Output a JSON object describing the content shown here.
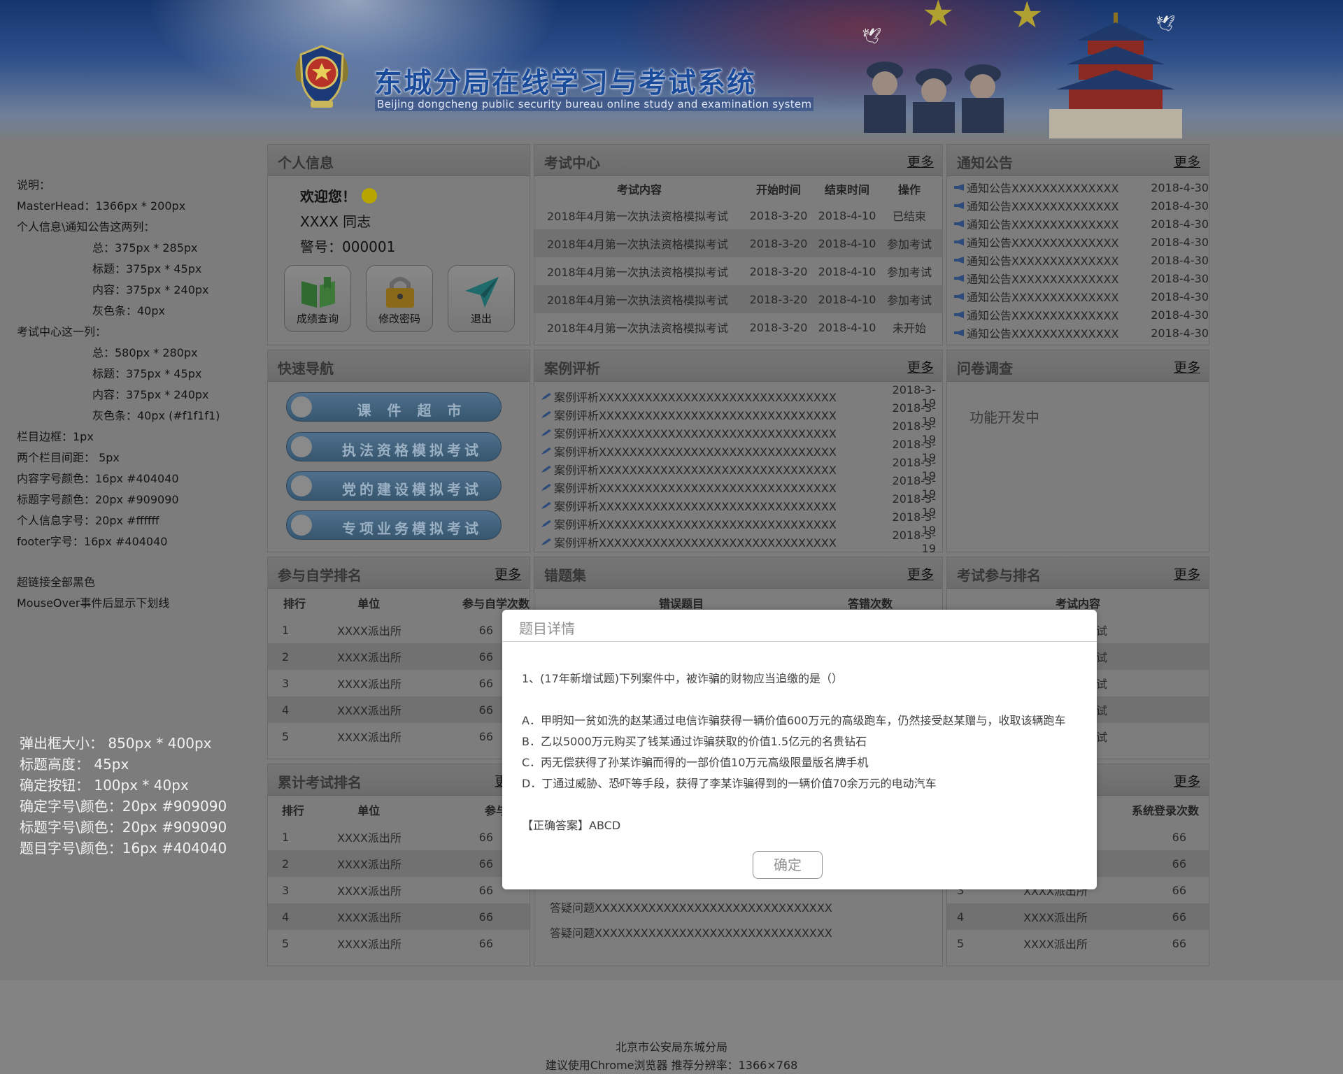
{
  "header": {
    "title": "东城分局在线学习与考试系统",
    "subtitle": "Beijing dongcheng public security bureau online study and examination system"
  },
  "notes": [
    "说明：",
    "MasterHead：1366px * 200px",
    "个人信息\\通知公告这两列：",
    "总：375px * 285px",
    "标题：375px * 45px",
    "内容：375px * 240px",
    "灰色条：40px",
    "考试中心这一列：",
    "总：580px * 280px",
    "标题：375px * 45px",
    "内容：375px * 240px",
    "灰色条：40px (#f1f1f1)",
    "栏目边框：1px",
    "两个栏目间距：  5px",
    "内容字号颜色：16px   #404040",
    "标题字号颜色：20px   #909090",
    "个人信息字号：20px   #ffffff",
    "footer字号：16px      #404040",
    "超链接全部黑色",
    "MouseOver事件后显示下划线"
  ],
  "notes2": [
    "弹出框大小：   850px * 400px",
    "标题高度：   45px",
    "确定按钮：   100px * 40px",
    "确定字号\\颜色：20px   #909090",
    "标题字号\\颜色：20px   #909090",
    "题目字号\\颜色：16px   #404040"
  ],
  "more": "更多",
  "personal": {
    "title": "个人信息",
    "welcome": "欢迎您！",
    "name": "XXXX   同志",
    "badge": "警号：000001",
    "buttons": [
      "成绩查询",
      "修改密码",
      "退出"
    ]
  },
  "exam_center": {
    "title": "考试中心",
    "headers": [
      "考试内容",
      "开始时间",
      "结束时间",
      "操作"
    ],
    "rows": [
      [
        "2018年4月第一次执法资格模拟考试",
        "2018-3-20",
        "2018-4-10",
        "已结束"
      ],
      [
        "2018年4月第一次执法资格模拟考试",
        "2018-3-20",
        "2018-4-10",
        "参加考试"
      ],
      [
        "2018年4月第一次执法资格模拟考试",
        "2018-3-20",
        "2018-4-10",
        "参加考试"
      ],
      [
        "2018年4月第一次执法资格模拟考试",
        "2018-3-20",
        "2018-4-10",
        "参加考试"
      ],
      [
        "2018年4月第一次执法资格模拟考试",
        "2018-3-20",
        "2018-4-10",
        "未开始"
      ]
    ]
  },
  "notices": {
    "title": "通知公告",
    "items": [
      [
        "通知公告XXXXXXXXXXXXXX",
        "2018-4-30"
      ],
      [
        "通知公告XXXXXXXXXXXXXX",
        "2018-4-30"
      ],
      [
        "通知公告XXXXXXXXXXXXXX",
        "2018-4-30"
      ],
      [
        "通知公告XXXXXXXXXXXXXX",
        "2018-4-30"
      ],
      [
        "通知公告XXXXXXXXXXXXXX",
        "2018-4-30"
      ],
      [
        "通知公告XXXXXXXXXXXXXX",
        "2018-4-30"
      ],
      [
        "通知公告XXXXXXXXXXXXXX",
        "2018-4-30"
      ],
      [
        "通知公告XXXXXXXXXXXXXX",
        "2018-4-30"
      ],
      [
        "通知公告XXXXXXXXXXXXXX",
        "2018-4-30"
      ]
    ]
  },
  "quicknav": {
    "title": "快速导航",
    "buttons": [
      "课 件 超 市",
      "执法资格模拟考试",
      "党的建设模拟考试",
      "专项业务模拟考试"
    ]
  },
  "cases": {
    "title": "案例评析",
    "items": [
      [
        "案例评析XXXXXXXXXXXXXXXXXXXXXXXXXXXXXXX",
        "2018-3-19"
      ],
      [
        "案例评析XXXXXXXXXXXXXXXXXXXXXXXXXXXXXXX",
        "2018-3-19"
      ],
      [
        "案例评析XXXXXXXXXXXXXXXXXXXXXXXXXXXXXXX",
        "2018-3-19"
      ],
      [
        "案例评析XXXXXXXXXXXXXXXXXXXXXXXXXXXXXXX",
        "2018-3-19"
      ],
      [
        "案例评析XXXXXXXXXXXXXXXXXXXXXXXXXXXXXXX",
        "2018-3-19"
      ],
      [
        "案例评析XXXXXXXXXXXXXXXXXXXXXXXXXXXXXXX",
        "2018-3-19"
      ],
      [
        "案例评析XXXXXXXXXXXXXXXXXXXXXXXXXXXXXXX",
        "2018-3-19"
      ],
      [
        "案例评析XXXXXXXXXXXXXXXXXXXXXXXXXXXXXXX",
        "2018-3-19"
      ],
      [
        "案例评析XXXXXXXXXXXXXXXXXXXXXXXXXXXXXXX",
        "2018-3-19"
      ]
    ]
  },
  "survey": {
    "title": "问卷调查",
    "text": "功能开发中"
  },
  "self_rank": {
    "title": "参与自学排名",
    "headers": [
      "排行",
      "单位",
      "参与自学次数"
    ],
    "rows": [
      [
        "1",
        "XXXX派出所",
        "66"
      ],
      [
        "2",
        "XXXX派出所",
        "66"
      ],
      [
        "3",
        "XXXX派出所",
        "66"
      ],
      [
        "4",
        "XXXX派出所",
        "66"
      ],
      [
        "5",
        "XXXX派出所",
        "66"
      ]
    ]
  },
  "errors": {
    "title": "错题集",
    "headers": [
      "错误题目",
      "答错次数"
    ]
  },
  "exam_rank": {
    "title": "考试参与排名",
    "headers": [
      "考试内容"
    ],
    "rows": [
      "考试",
      "考试",
      "考试",
      "考试",
      "考试"
    ]
  },
  "total_rank": {
    "title": "累计考试排名",
    "headers": [
      "排行",
      "单位",
      "参与考试"
    ],
    "rows": [
      [
        "1",
        "XXXX派出所",
        "66"
      ],
      [
        "2",
        "XXXX派出所",
        "66"
      ],
      [
        "3",
        "XXXX派出所",
        "66"
      ],
      [
        "4",
        "XXXX派出所",
        "66"
      ],
      [
        "5",
        "XXXX派出所",
        "66"
      ]
    ]
  },
  "qa": {
    "items": [
      "答疑问题XXXXXXXXXXXXXXXXXXXXXXXXXXXXXXX",
      "答疑问题XXXXXXXXXXXXXXXXXXXXXXXXXXXXXXX",
      "答疑问题XXXXXXXXXXXXXXXXXXXXXXXXXXXXXXX"
    ]
  },
  "login_rank": {
    "headers": [
      "系统登录次数"
    ],
    "rows": [
      [
        "",
        "",
        "66"
      ],
      [
        "",
        "",
        "66"
      ],
      [
        "3",
        "XXXX派出所",
        "66"
      ],
      [
        "4",
        "XXXX派出所",
        "66"
      ],
      [
        "5",
        "XXXX派出所",
        "66"
      ]
    ]
  },
  "dialog": {
    "title": "题目详情",
    "question": "1、(17年新增试题)下列案件中，被诈骗的财物应当追缴的是（）",
    "options": [
      "A．甲明知一贫如洗的赵某通过电信诈骗获得一辆价值600万元的高级跑车，仍然接受赵某赠与，收取该辆跑车",
      "B．乙以5000万元购买了钱某通过诈骗获取的价值1.5亿元的名贵钻石",
      "C．丙无偿获得了孙某诈骗而得的一部价值10万元高级限量版名牌手机",
      "D．丁通过威胁、恐吓等手段，获得了李某诈骗得到的一辆价值70余万元的电动汽车"
    ],
    "answer": "【正确答案】ABCD",
    "ok": "确定"
  },
  "footer": {
    "line1": "北京市公安局东城分局",
    "line2": "建议使用Chrome浏览器   推荐分辨率：1366×768"
  },
  "colors": {
    "title_blue": "#1a4a9a",
    "dialog_title": "#909090",
    "dialog_text": "#404040",
    "panel_bg": "#7d7d7d"
  }
}
